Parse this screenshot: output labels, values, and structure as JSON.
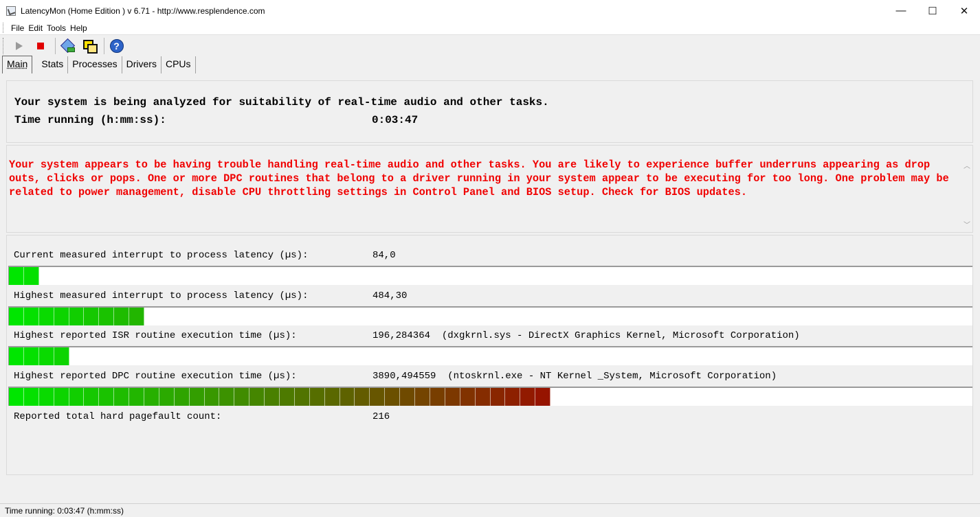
{
  "window": {
    "title": "LatencyMon  (Home Edition )  v 6.71 - http://www.resplendence.com",
    "minimize": "—",
    "maximize": "☐",
    "close": "✕"
  },
  "menu": {
    "items": [
      "File",
      "Edit",
      "Tools",
      "Help"
    ]
  },
  "toolbar": {
    "buttons": [
      {
        "name": "play-icon",
        "enabled": false
      },
      {
        "name": "stop-icon",
        "color": "#e00000"
      },
      {
        "name": "tools-icon"
      },
      {
        "name": "windows-icon"
      },
      {
        "name": "help-icon",
        "glyph": "?"
      }
    ]
  },
  "tabs": [
    "Main",
    "Stats",
    "Processes",
    "Drivers",
    "CPUs"
  ],
  "main": {
    "analyzed_text": "Your system is being analyzed for suitability of real-time audio and other tasks.",
    "time_running_label": "Time running (h:mm:ss):",
    "time_running_value": "0:03:47",
    "warning": "Your system appears to be having trouble handling real-time audio and other tasks. You are likely to experience buffer underruns appearing as drop outs, clicks or pops. One or more DPC routines that belong to a driver running in your system appear to be executing for too long. One problem may be related to power management, disable CPU throttling settings in Control Panel and BIOS setup. Check for BIOS updates.",
    "warning_color": "#f00000",
    "metrics": [
      {
        "label": "Current measured interrupt to process latency (µs):",
        "value": "84,0",
        "detail": "",
        "segments": 2
      },
      {
        "label": "Highest measured interrupt to process latency (µs):",
        "value": "484,30",
        "detail": "",
        "segments": 9
      },
      {
        "label": "Highest reported ISR routine execution time (µs):",
        "value": "196,284364",
        "detail": "(dxgkrnl.sys - DirectX Graphics Kernel, Microsoft Corporation)",
        "segments": 4
      },
      {
        "label": "Highest reported DPC routine execution time (µs):",
        "value": "3890,494559",
        "detail": "(ntoskrnl.exe - NT Kernel _System, Microsoft Corporation)",
        "segments": 36
      }
    ],
    "pagefault_label": "Reported total hard pagefault count:",
    "pagefault_value": "216"
  },
  "status": {
    "text": "Time running: 0:03:47  (h:mm:ss)"
  }
}
